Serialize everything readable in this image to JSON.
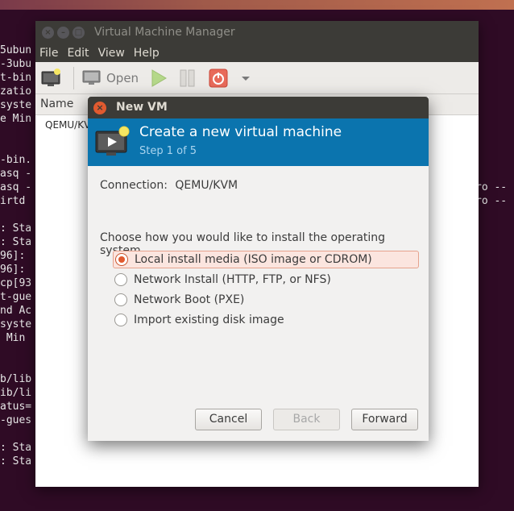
{
  "terminal": {
    "left_lines": [
      "5ubun",
      "-3ubu",
      "t-bin",
      "zatio",
      "syste",
      "e Min",
      "",
      "",
      "-bin.",
      "asq -",
      "asq -",
      "irtd",
      "",
      ": Sta",
      ": Sta",
      "96]:",
      "96]:",
      "cp[93",
      "t-gue",
      "nd Ac",
      "syste",
      " Min",
      "",
      "",
      "b/lib",
      "ib/li",
      "atus=",
      "-gues",
      "",
      ": Sta",
      ": Sta"
    ],
    "right_lines": [
      "ro --",
      "ro --"
    ]
  },
  "vmm": {
    "title": "Virtual Machine Manager",
    "menu": [
      "File",
      "Edit",
      "View",
      "Help"
    ],
    "toolbar": {
      "open_label": "Open"
    },
    "list": {
      "column_name": "Name",
      "row_name": "QEMU/KVM"
    }
  },
  "dialog": {
    "title": "New VM",
    "header_title": "Create a new virtual machine",
    "step": "Step 1 of 5",
    "connection_label": "Connection:",
    "connection_value": "QEMU/KVM",
    "prompt": "Choose how you would like to install the operating system",
    "options": [
      {
        "label": "Local install media (ISO image or CDROM)",
        "selected": true
      },
      {
        "label": "Network Install (HTTP, FTP, or NFS)",
        "selected": false
      },
      {
        "label": "Network Boot (PXE)",
        "selected": false
      },
      {
        "label": "Import existing disk image",
        "selected": false
      }
    ],
    "buttons": {
      "cancel": "Cancel",
      "back": "Back",
      "forward": "Forward"
    }
  },
  "colors": {
    "header_blue": "#0b74ae",
    "accent_orange": "#e15a2f",
    "titlebar": "#3c3b37"
  }
}
